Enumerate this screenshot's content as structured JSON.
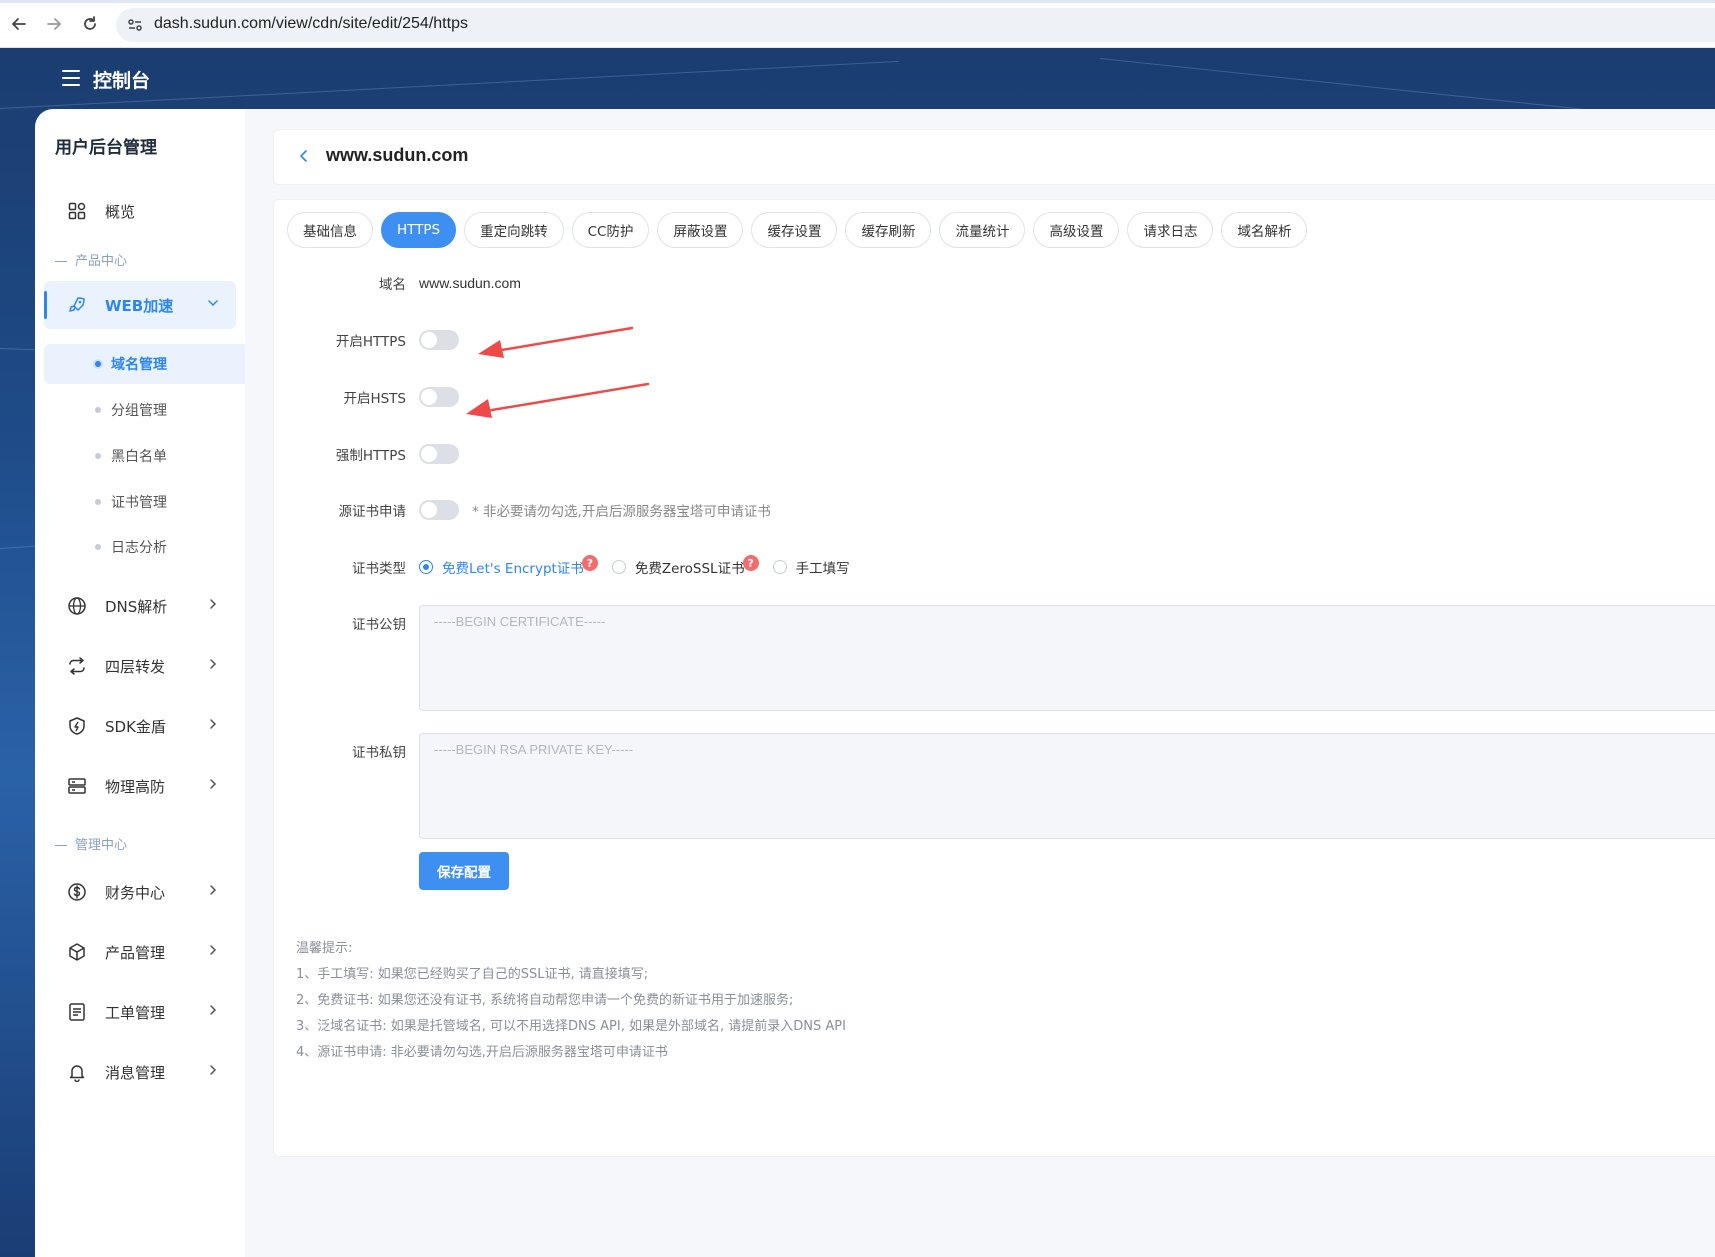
{
  "browser": {
    "url": "dash.sudun.com/view/cdn/site/edit/254/https"
  },
  "topbar": {
    "title": "控制台"
  },
  "sidebar": {
    "title": "用户后台管理",
    "overview": "概览",
    "section_product": "产品中心",
    "web": "WEB加速",
    "sub_items": [
      "域名管理",
      "分组管理",
      "黑白名单",
      "证书管理",
      "日志分析"
    ],
    "dns": "DNS解析",
    "l4": "四层转发",
    "sdk": "SDK金盾",
    "physical": "物理高防",
    "section_manage": "管理中心",
    "finance": "财务中心",
    "products": "产品管理",
    "tickets": "工单管理",
    "messages": "消息管理"
  },
  "header": {
    "site": "www.sudun.com"
  },
  "tabs": [
    "基础信息",
    "HTTPS",
    "重定向跳转",
    "CC防护",
    "屏蔽设置",
    "缓存设置",
    "缓存刷新",
    "流量统计",
    "高级设置",
    "请求日志",
    "域名解析"
  ],
  "active_tab": "HTTPS",
  "form": {
    "domain_label": "域名",
    "domain_value": "www.sudun.com",
    "https_label": "开启HTTPS",
    "hsts_label": "开启HSTS",
    "force_label": "强制HTTPS",
    "origin_label": "源证书申请",
    "origin_hint": "* 非必要请勿勾选,开启后源服务器宝塔可申请证书",
    "cert_type_label": "证书类型",
    "cert_types": [
      "免费Let's Encrypt证书",
      "免费ZeroSSL证书",
      "手工填写"
    ],
    "pubkey_label": "证书公钥",
    "pubkey_placeholder": "-----BEGIN CERTIFICATE-----",
    "privkey_label": "证书私钥",
    "privkey_placeholder": "-----BEGIN RSA PRIVATE KEY-----",
    "save": "保存配置"
  },
  "tips": {
    "title": "温馨提示:",
    "lines": [
      "1、手工填写: 如果您已经购买了自己的SSL证书, 请直接填写;",
      "2、免费证书: 如果您还没有证书, 系统将自动帮您申请一个免费的新证书用于加速服务;",
      "3、泛域名证书: 如果是托管域名, 可以不用选择DNS API, 如果是外部域名, 请提前录入DNS API",
      "4、源证书申请: 非必要请勿勾选,开启后源服务器宝塔可申请证书"
    ]
  },
  "colors": {
    "accent": "#3d8ff2",
    "annotation_arrow": "#ef4a4a"
  }
}
